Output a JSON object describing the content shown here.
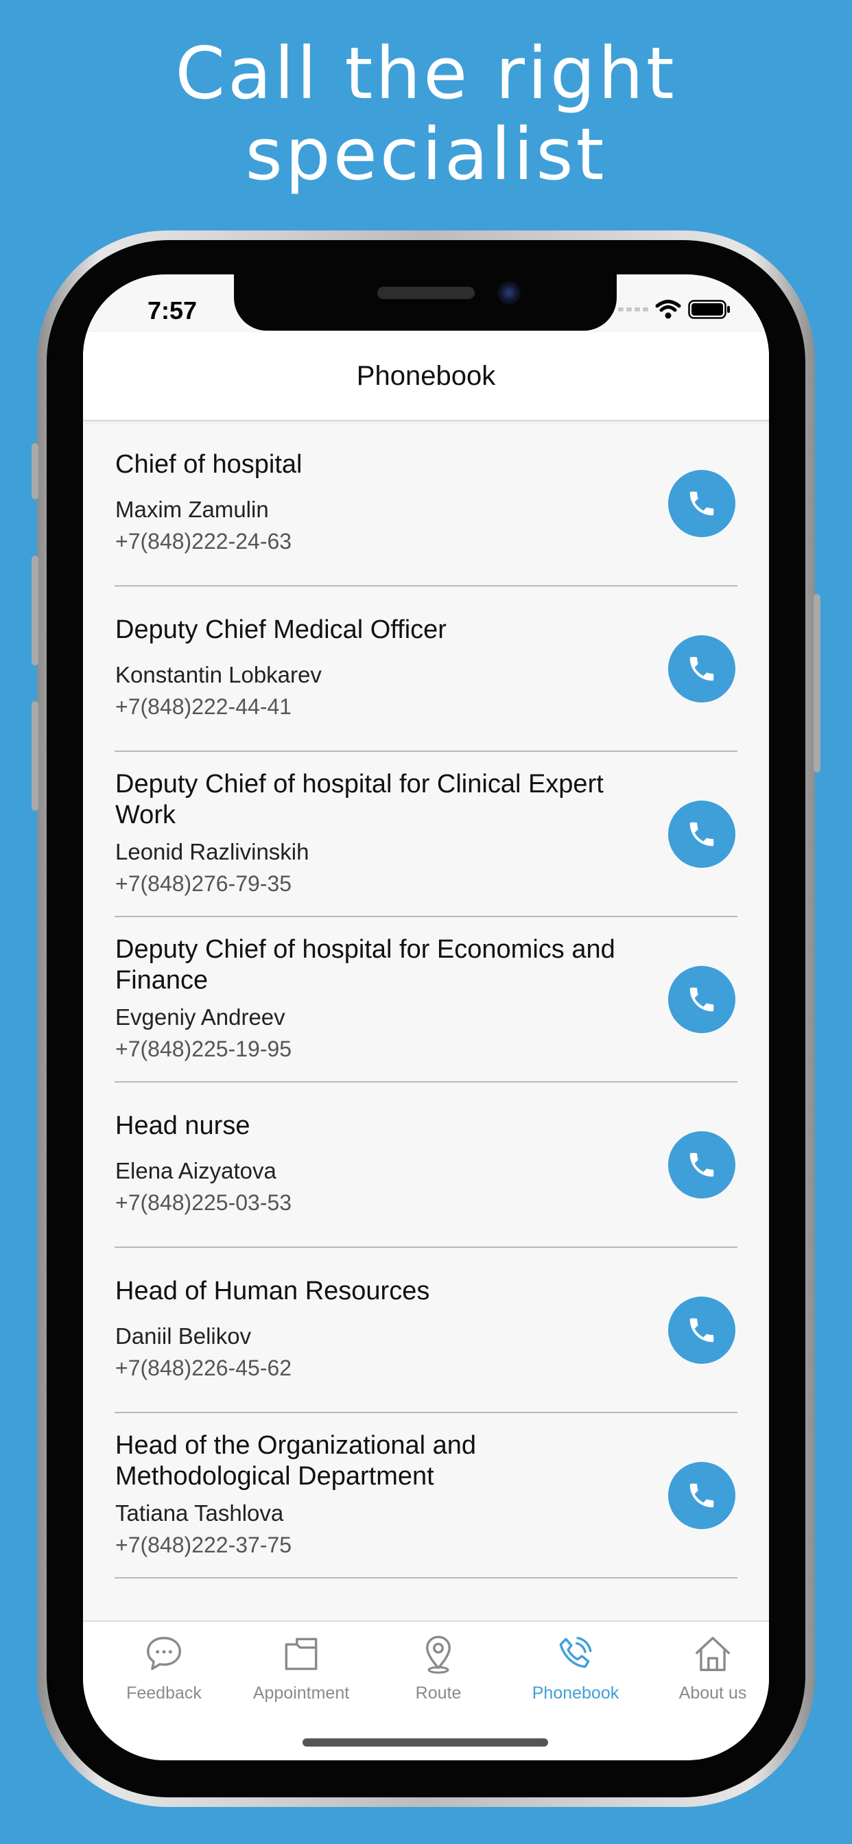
{
  "headline": {
    "line1": "Call the right",
    "line2": "specialist"
  },
  "status_bar": {
    "time": "7:57"
  },
  "navbar": {
    "title": "Phonebook"
  },
  "contacts": [
    {
      "title": "Chief of hospital",
      "name": "Maxim Zamulin",
      "phone": "+7(848)222-24-63"
    },
    {
      "title": "Deputy Chief Medical Officer",
      "name": "Konstantin Lobkarev",
      "phone": "+7(848)222-44-41"
    },
    {
      "title": "Deputy Chief of hospital for Clinical Expert Work",
      "name": "Leonid Razlivinskih",
      "phone": "+7(848)276-79-35"
    },
    {
      "title": "Deputy Chief of hospital for Economics and Finance",
      "name": "Evgeniy Andreev",
      "phone": "+7(848)225-19-95"
    },
    {
      "title": "Head nurse",
      "name": "Elena Aizyatova",
      "phone": "+7(848)225-03-53"
    },
    {
      "title": "Head of Human Resources",
      "name": "Daniil Belikov",
      "phone": "+7(848)226-45-62"
    },
    {
      "title": "Head of the Organizational and Methodological Department",
      "name": "Tatiana Tashlova",
      "phone": "+7(848)222-37-75"
    }
  ],
  "call_icon": "phone-icon",
  "tabbar": {
    "tabs": [
      {
        "label": "Feedback",
        "icon": "chat-bubble-icon",
        "active": false
      },
      {
        "label": "Appointment",
        "icon": "folder-icon",
        "active": false
      },
      {
        "label": "Route",
        "icon": "map-pin-icon",
        "active": false
      },
      {
        "label": "Phonebook",
        "icon": "phone-ringing-icon",
        "active": true
      },
      {
        "label": "About us",
        "icon": "home-icon",
        "active": false
      }
    ]
  },
  "colors": {
    "background": "#3f9fd8",
    "accent": "#3f9fd8",
    "screen": "#f7f7f7",
    "inactive_tab": "#8a8a8a"
  }
}
